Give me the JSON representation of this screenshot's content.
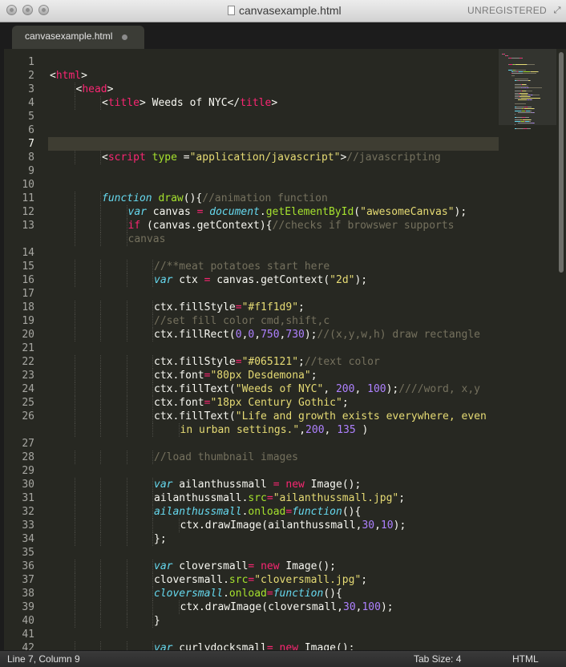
{
  "window": {
    "title": "canvasexample.html",
    "license_status": "UNREGISTERED"
  },
  "tabs": [
    {
      "label": "canvasexample.html",
      "modified": true
    }
  ],
  "editor": {
    "current_line": 7,
    "lines": [
      {
        "n": "1",
        "indent": 0,
        "tokens": []
      },
      {
        "n": "2",
        "indent": 0,
        "tokens": [
          [
            "p",
            "<"
          ],
          [
            "t",
            "html"
          ],
          [
            "p",
            ">"
          ]
        ]
      },
      {
        "n": "3",
        "indent": 1,
        "tokens": [
          [
            "p",
            "<"
          ],
          [
            "t",
            "head"
          ],
          [
            "p",
            ">"
          ]
        ]
      },
      {
        "n": "4",
        "indent": 2,
        "tokens": [
          [
            "p",
            "<"
          ],
          [
            "t",
            "title"
          ],
          [
            "p",
            "> Weeds of NYC</"
          ],
          [
            "t",
            "title"
          ],
          [
            "p",
            ">"
          ]
        ]
      },
      {
        "n": "5",
        "indent": 0,
        "tokens": []
      },
      {
        "n": "6",
        "indent": 0,
        "tokens": []
      },
      {
        "n": "7",
        "indent": 0,
        "tokens": []
      },
      {
        "n": "8",
        "indent": 2,
        "tokens": [
          [
            "p",
            "<"
          ],
          [
            "t",
            "script"
          ],
          [
            "p",
            " "
          ],
          [
            "a",
            "type"
          ],
          [
            "p",
            " ="
          ],
          [
            "s",
            "\"application/javascript\""
          ],
          [
            "p",
            ">"
          ],
          [
            "c",
            "//javascripting"
          ]
        ]
      },
      {
        "n": "9",
        "indent": 0,
        "tokens": []
      },
      {
        "n": "10",
        "indent": 0,
        "tokens": []
      },
      {
        "n": "11",
        "indent": 2,
        "tokens": [
          [
            "k",
            "function"
          ],
          [
            "p",
            " "
          ],
          [
            "f",
            "draw"
          ],
          [
            "p",
            "(){"
          ],
          [
            "c",
            "//animation function"
          ]
        ]
      },
      {
        "n": "12",
        "indent": 3,
        "tokens": [
          [
            "k",
            "var"
          ],
          [
            "p",
            " canvas "
          ],
          [
            "t",
            "="
          ],
          [
            "p",
            " "
          ],
          [
            "k",
            "document"
          ],
          [
            "p",
            "."
          ],
          [
            "f",
            "getElementById"
          ],
          [
            "p",
            "("
          ],
          [
            "s",
            "\"awesomeCanvas\""
          ],
          [
            "p",
            ");"
          ]
        ]
      },
      {
        "n": "13",
        "indent": 3,
        "tokens": [
          [
            "t",
            "if"
          ],
          [
            "p",
            " (canvas.getContext){"
          ],
          [
            "c",
            "//checks if browswer supports"
          ]
        ]
      },
      {
        "n": "",
        "indent": 3,
        "tokens": [
          [
            "c",
            "canvas"
          ]
        ]
      },
      {
        "n": "14",
        "indent": 0,
        "tokens": []
      },
      {
        "n": "15",
        "indent": 4,
        "tokens": [
          [
            "c",
            "//**meat potatoes start here"
          ]
        ]
      },
      {
        "n": "16",
        "indent": 4,
        "tokens": [
          [
            "k",
            "var"
          ],
          [
            "p",
            " ctx "
          ],
          [
            "t",
            "="
          ],
          [
            "p",
            " canvas.getContext("
          ],
          [
            "s",
            "\"2d\""
          ],
          [
            "p",
            ");"
          ]
        ]
      },
      {
        "n": "17",
        "indent": 0,
        "tokens": []
      },
      {
        "n": "18",
        "indent": 4,
        "tokens": [
          [
            "p",
            "ctx.fillStyle"
          ],
          [
            "t",
            "="
          ],
          [
            "s",
            "\"#f1f1d9\""
          ],
          [
            "p",
            ";"
          ]
        ]
      },
      {
        "n": "19",
        "indent": 4,
        "tokens": [
          [
            "c",
            "//set fill color cmd,shift,c"
          ]
        ]
      },
      {
        "n": "20",
        "indent": 4,
        "tokens": [
          [
            "p",
            "ctx.fillRect("
          ],
          [
            "n",
            "0"
          ],
          [
            "p",
            ","
          ],
          [
            "n",
            "0"
          ],
          [
            "p",
            ","
          ],
          [
            "n",
            "750"
          ],
          [
            "p",
            ","
          ],
          [
            "n",
            "730"
          ],
          [
            "p",
            ");"
          ],
          [
            "c",
            "//(x,y,w,h) draw rectangle"
          ]
        ]
      },
      {
        "n": "21",
        "indent": 0,
        "tokens": []
      },
      {
        "n": "22",
        "indent": 4,
        "tokens": [
          [
            "p",
            "ctx.fillStyle"
          ],
          [
            "t",
            "="
          ],
          [
            "s",
            "\"#065121\""
          ],
          [
            "p",
            ";"
          ],
          [
            "c",
            "//text color"
          ]
        ]
      },
      {
        "n": "23",
        "indent": 4,
        "tokens": [
          [
            "p",
            "ctx.font"
          ],
          [
            "t",
            "="
          ],
          [
            "s",
            "\"80px Desdemona\""
          ],
          [
            "p",
            ";"
          ]
        ]
      },
      {
        "n": "24",
        "indent": 4,
        "tokens": [
          [
            "p",
            "ctx.fillText("
          ],
          [
            "s",
            "\"Weeds of NYC\""
          ],
          [
            "p",
            ", "
          ],
          [
            "n",
            "200"
          ],
          [
            "p",
            ", "
          ],
          [
            "n",
            "100"
          ],
          [
            "p",
            ");"
          ],
          [
            "c",
            "////word, x,y"
          ]
        ]
      },
      {
        "n": "25",
        "indent": 4,
        "tokens": [
          [
            "p",
            "ctx.font"
          ],
          [
            "t",
            "="
          ],
          [
            "s",
            "\"18px Century Gothic\""
          ],
          [
            "p",
            ";"
          ]
        ]
      },
      {
        "n": "26",
        "indent": 4,
        "tokens": [
          [
            "p",
            "ctx.fillText("
          ],
          [
            "s",
            "\"Life and growth exists everywhere, even"
          ]
        ]
      },
      {
        "n": "",
        "indent": 5,
        "tokens": [
          [
            "s",
            "in urban settings.\""
          ],
          [
            "p",
            ","
          ],
          [
            "n",
            "200"
          ],
          [
            "p",
            ", "
          ],
          [
            "n",
            "135"
          ],
          [
            "p",
            " )"
          ]
        ]
      },
      {
        "n": "27",
        "indent": 0,
        "tokens": []
      },
      {
        "n": "28",
        "indent": 4,
        "tokens": [
          [
            "c",
            "//load thumbnail images"
          ]
        ]
      },
      {
        "n": "29",
        "indent": 0,
        "tokens": []
      },
      {
        "n": "30",
        "indent": 4,
        "tokens": [
          [
            "k",
            "var"
          ],
          [
            "p",
            " ailanthussmall "
          ],
          [
            "t",
            "="
          ],
          [
            "p",
            " "
          ],
          [
            "t",
            "new"
          ],
          [
            "p",
            " Image();"
          ]
        ]
      },
      {
        "n": "31",
        "indent": 4,
        "tokens": [
          [
            "p",
            "ailanthussmall."
          ],
          [
            "f",
            "src"
          ],
          [
            "t",
            "="
          ],
          [
            "s",
            "\"ailanthussmall.jpg\""
          ],
          [
            "p",
            ";"
          ]
        ]
      },
      {
        "n": "32",
        "indent": 4,
        "tokens": [
          [
            "k",
            "ailanthussmall"
          ],
          [
            "p",
            "."
          ],
          [
            "f",
            "onload"
          ],
          [
            "t",
            "="
          ],
          [
            "k",
            "function"
          ],
          [
            "p",
            "(){"
          ]
        ]
      },
      {
        "n": "33",
        "indent": 5,
        "tokens": [
          [
            "p",
            "ctx.drawImage(ailanthussmall,"
          ],
          [
            "n",
            "30"
          ],
          [
            "p",
            ","
          ],
          [
            "n",
            "10"
          ],
          [
            "p",
            ");"
          ]
        ]
      },
      {
        "n": "34",
        "indent": 4,
        "tokens": [
          [
            "p",
            "};"
          ]
        ]
      },
      {
        "n": "35",
        "indent": 0,
        "tokens": []
      },
      {
        "n": "36",
        "indent": 4,
        "tokens": [
          [
            "k",
            "var"
          ],
          [
            "p",
            " cloversmall"
          ],
          [
            "t",
            "="
          ],
          [
            "p",
            " "
          ],
          [
            "t",
            "new"
          ],
          [
            "p",
            " Image();"
          ]
        ]
      },
      {
        "n": "37",
        "indent": 4,
        "tokens": [
          [
            "p",
            "cloversmall."
          ],
          [
            "f",
            "src"
          ],
          [
            "t",
            "="
          ],
          [
            "s",
            "\"cloversmall.jpg\""
          ],
          [
            "p",
            ";"
          ]
        ]
      },
      {
        "n": "38",
        "indent": 4,
        "tokens": [
          [
            "k",
            "cloversmall"
          ],
          [
            "p",
            "."
          ],
          [
            "f",
            "onload"
          ],
          [
            "t",
            "="
          ],
          [
            "k",
            "function"
          ],
          [
            "p",
            "(){"
          ]
        ]
      },
      {
        "n": "39",
        "indent": 5,
        "tokens": [
          [
            "p",
            "ctx.drawImage(cloversmall,"
          ],
          [
            "n",
            "30"
          ],
          [
            "p",
            ","
          ],
          [
            "n",
            "100"
          ],
          [
            "p",
            ");"
          ]
        ]
      },
      {
        "n": "40",
        "indent": 4,
        "tokens": [
          [
            "p",
            "}"
          ]
        ]
      },
      {
        "n": "41",
        "indent": 0,
        "tokens": []
      },
      {
        "n": "42",
        "indent": 4,
        "tokens": [
          [
            "k",
            "var"
          ],
          [
            "p",
            " curlydocksmall"
          ],
          [
            "t",
            "="
          ],
          [
            "p",
            " "
          ],
          [
            "t",
            "new"
          ],
          [
            "p",
            " Image();"
          ]
        ]
      }
    ]
  },
  "status": {
    "position": "Line 7, Column 9",
    "tab_size": "Tab Size: 4",
    "syntax": "HTML"
  },
  "colors": {
    "background": "#272822",
    "tag": "#f92672",
    "string": "#e6db74",
    "comment": "#75715e",
    "keyword": "#66d9ef",
    "function": "#a6e22e",
    "number": "#ae81ff"
  }
}
